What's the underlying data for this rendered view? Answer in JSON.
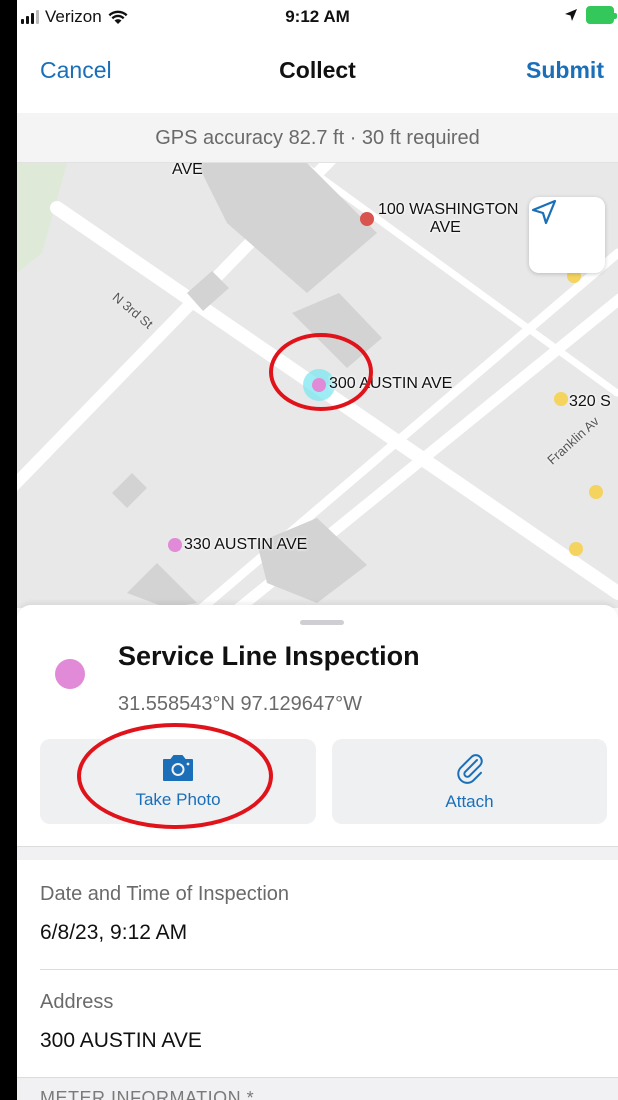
{
  "status_bar": {
    "carrier": "Verizon",
    "time": "9:12 AM"
  },
  "nav": {
    "cancel_label": "Cancel",
    "title": "Collect",
    "submit_label": "Submit"
  },
  "gps_banner": "GPS accuracy 82.7 ft  ·  30 ft required",
  "map": {
    "labels": {
      "top_ave": "AVE",
      "washington": "100  WASHINGTON",
      "washington_ave": "AVE",
      "austin_300": "300  AUSTIN AVE",
      "s_320": "320 S",
      "austin_330": "330  AUSTIN AVE"
    },
    "streets": {
      "n3rd": "N 3rd St",
      "franklin": "Franklin Av"
    },
    "colors": {
      "selected_point": "#e08ad8",
      "red_point": "#d9534f",
      "yellow_point": "#f4d35e",
      "accuracy_halo": "#7fe7f0"
    }
  },
  "feature": {
    "title": "Service Line Inspection",
    "coords": "31.558543°N  97.129647°W",
    "color": "#e08ad8"
  },
  "actions": {
    "take_photo": "Take Photo",
    "attach": "Attach"
  },
  "fields": {
    "date_label": "Date and Time of Inspection",
    "date_value": "6/8/23, 9:12 AM",
    "address_label": "Address",
    "address_value": "300  AUSTIN AVE",
    "meter_label": "METER INFORMATION *"
  },
  "accent_color": "#1a6fb8"
}
